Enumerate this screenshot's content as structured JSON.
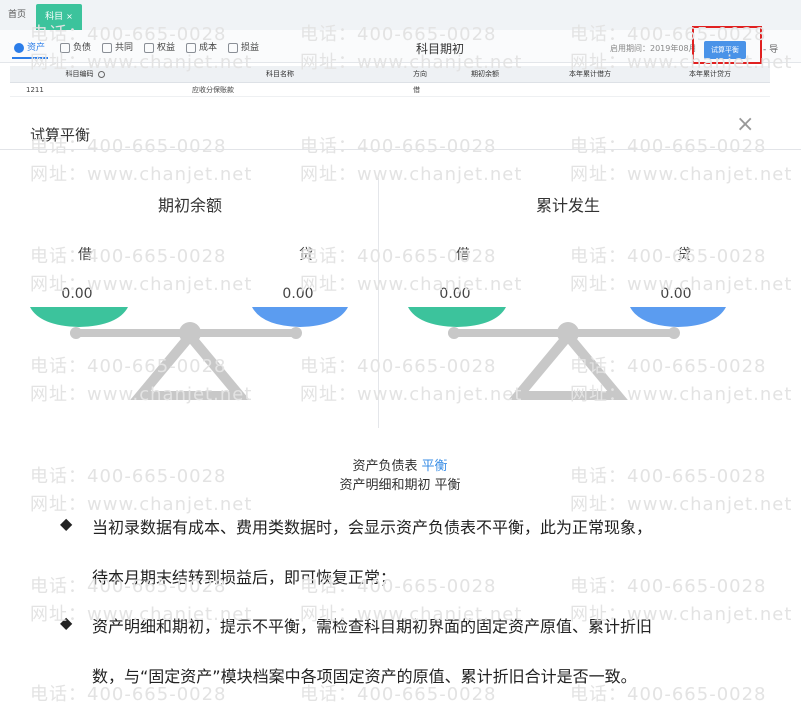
{
  "top_tabs": {
    "home": "首页",
    "active_tab": "科目",
    "active_tab_close": "×"
  },
  "toolbar": {
    "categories": [
      "资产",
      "负债",
      "共同",
      "权益",
      "成本",
      "损益"
    ],
    "page_title": "科目期初",
    "period_label": "启用期间：",
    "period_value": "2019年08月",
    "trial_button": "试算平衡",
    "more": "- 导"
  },
  "table": {
    "headers": [
      "科目编码",
      "科目名称",
      "方向",
      "期初余额",
      "本年累计借方",
      "本年累计贷方"
    ],
    "row": {
      "code": "1211",
      "name": "应收分保账款",
      "direction": "借"
    }
  },
  "dialog": {
    "title": "试算平衡",
    "close": "×",
    "left": {
      "title": "期初余额",
      "debit_label": "借",
      "credit_label": "贷",
      "debit": "0.00",
      "credit": "0.00"
    },
    "right": {
      "title": "累计发生",
      "debit_label": "借",
      "credit_label": "贷",
      "debit": "0.00",
      "credit": "0.00"
    },
    "status": [
      {
        "label": "资产负债表",
        "value": "平衡"
      },
      {
        "label": "资产明细和期初",
        "value": "平衡"
      }
    ]
  },
  "notes": [
    [
      "当初录数据有成本、费用类数据时，会显示资产负债表不平衡，此为正常现象，",
      "待本月期末结转到损益后，即可恢复正常；"
    ],
    [
      "资产明细和期初，提示不平衡，需检查科目期初界面的固定资产原值、累计折旧",
      "数，与“固定资产”模块档案中各项固定资产的原值、累计折旧合计是否一致。"
    ]
  ],
  "bullet_symbol": "◆",
  "watermark": {
    "phone": "电话：400-665-0028",
    "site": "网址：www.chanjet.net"
  },
  "colors": {
    "accent_blue": "#4a93e8",
    "accent_green": "#3cc39c",
    "highlight_red": "#e02020",
    "scale_gray": "#c8c8c8"
  }
}
